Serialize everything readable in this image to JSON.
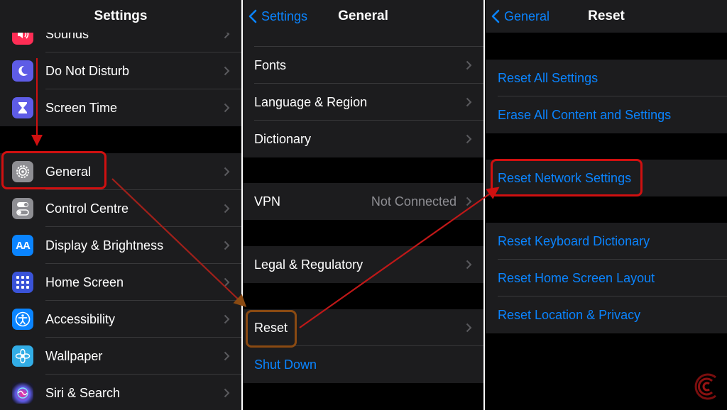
{
  "panel1": {
    "title": "Settings",
    "rows": [
      {
        "label": "Sounds",
        "icon": "speaker-icon"
      },
      {
        "label": "Do Not Disturb",
        "icon": "moon-icon"
      },
      {
        "label": "Screen Time",
        "icon": "hourglass-icon"
      },
      {
        "label": "General",
        "icon": "gear-icon"
      },
      {
        "label": "Control Centre",
        "icon": "toggles-icon"
      },
      {
        "label": "Display & Brightness",
        "icon": "text-size-icon"
      },
      {
        "label": "Home Screen",
        "icon": "app-grid-icon"
      },
      {
        "label": "Accessibility",
        "icon": "accessibility-icon"
      },
      {
        "label": "Wallpaper",
        "icon": "flower-icon"
      },
      {
        "label": "Siri & Search",
        "icon": "siri-icon"
      }
    ],
    "icon_text": {
      "display": "AA"
    }
  },
  "panel2": {
    "back_label": "Settings",
    "title": "General",
    "rows": [
      {
        "label": "Fonts"
      },
      {
        "label": "Language & Region"
      },
      {
        "label": "Dictionary"
      },
      {
        "label": "VPN",
        "value": "Not Connected"
      },
      {
        "label": "Legal & Regulatory"
      },
      {
        "label": "Reset"
      },
      {
        "label": "Shut Down"
      }
    ]
  },
  "panel3": {
    "back_label": "General",
    "title": "Reset",
    "rows": [
      {
        "label": "Reset All Settings"
      },
      {
        "label": "Erase All Content and Settings"
      },
      {
        "label": "Reset Network Settings"
      },
      {
        "label": "Reset Keyboard Dictionary"
      },
      {
        "label": "Reset Home Screen Layout"
      },
      {
        "label": "Reset Location & Privacy"
      }
    ]
  },
  "colors": {
    "accent": "#0a84ff",
    "highlight": "#d01010",
    "highlight_secondary": "#8a4a12",
    "cell_background": "#1c1c1e",
    "separator": "#38383a",
    "icon_sounds": "#ff2d55",
    "icon_do_not_disturb": "#5e5ce6",
    "icon_screen_time": "#5e5ce6",
    "icon_general": "#8e8e93",
    "icon_control_centre": "#8e8e93",
    "icon_display": "#0a84ff",
    "icon_home_screen": "#3a53d8",
    "icon_accessibility": "#0a84ff",
    "icon_wallpaper": "#32ade6",
    "icon_siri": "#2a2a4a"
  }
}
